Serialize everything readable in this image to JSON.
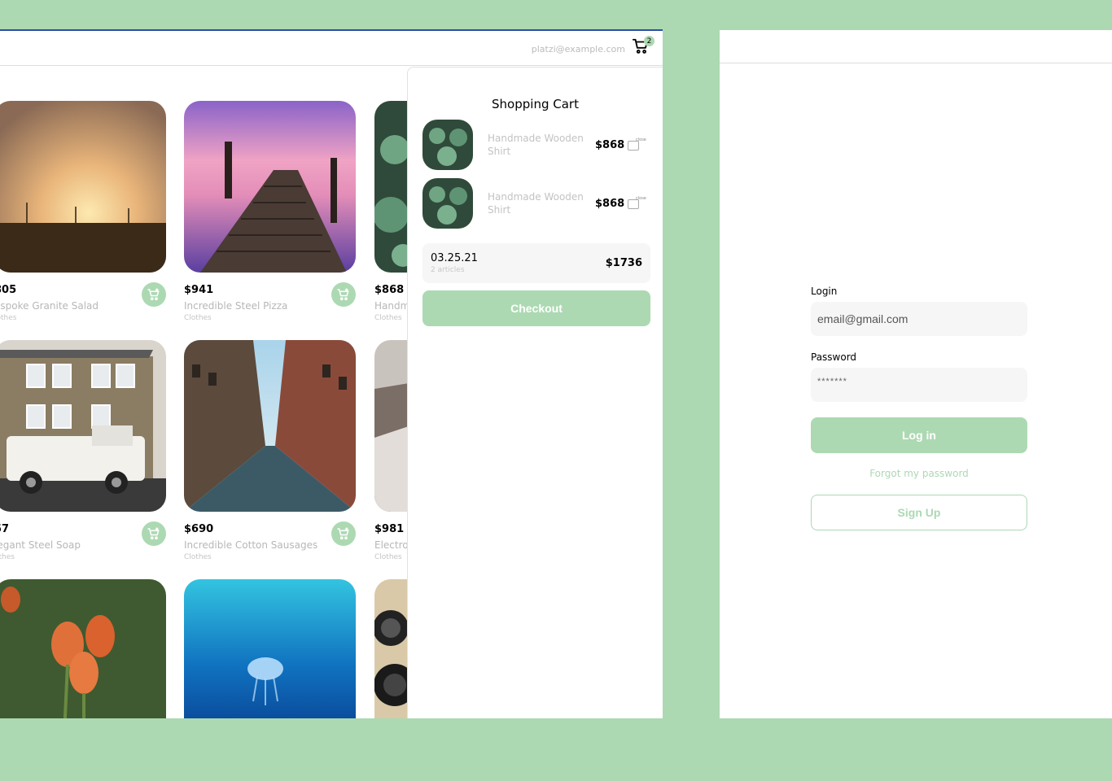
{
  "store": {
    "nav": {
      "email": "platzi@example.com",
      "cart_count": "2"
    },
    "products": [
      {
        "price": "805",
        "name": "espoke Granite Salad",
        "category": "lothes",
        "image": "sunset-field"
      },
      {
        "price": "$941",
        "name": "Incredible Steel Pizza",
        "category": "Clothes",
        "image": "pier-lake"
      },
      {
        "price": "$868",
        "name": "Handm",
        "category": "Clothes",
        "image": "succulents"
      },
      {
        "price": "57",
        "name": "legant Steel Soap",
        "category": "othes",
        "image": "house-jeep"
      },
      {
        "price": "$690",
        "name": "Incredible Cotton Sausages",
        "category": "Clothes",
        "image": "city-street"
      },
      {
        "price": "$981",
        "name": "Electro",
        "category": "Clothes",
        "image": "rocky-shore"
      },
      {
        "price": "",
        "name": "",
        "category": "",
        "image": "tulips"
      },
      {
        "price": "",
        "name": "",
        "category": "",
        "image": "jellyfish"
      },
      {
        "price": "",
        "name": "",
        "category": "",
        "image": "cameras"
      }
    ]
  },
  "cart": {
    "title": "Shopping Cart",
    "items": [
      {
        "name": "Handmade Wooden Shirt",
        "price": "$868",
        "close_alt": "close"
      },
      {
        "name": "Handmade Wooden Shirt",
        "price": "$868",
        "close_alt": "close"
      }
    ],
    "order": {
      "date": "03.25.21",
      "articles": "2 articles",
      "total": "$1736"
    },
    "checkout_label": "Checkout"
  },
  "login": {
    "login_label": "Login",
    "email_value": "email@gmail.com",
    "password_label": "Password",
    "password_value": "*******",
    "login_button": "Log in",
    "forgot_link": "Forgot my password",
    "signup_button": "Sign Up"
  },
  "colors": {
    "accent": "#acd9b2",
    "background": "#acd9b2",
    "muted_text": "#c3c3c3"
  }
}
